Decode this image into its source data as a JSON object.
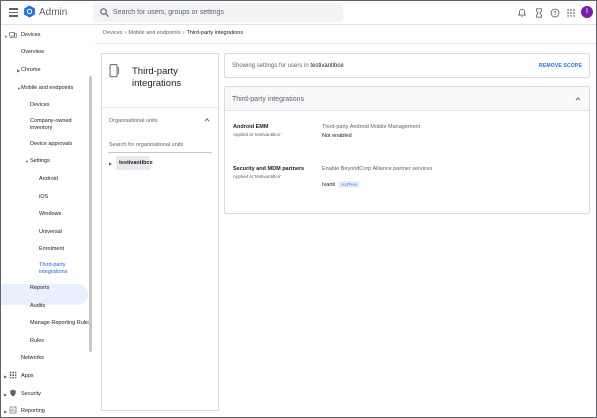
{
  "header": {
    "app_title": "Admin",
    "search_placeholder": "Search for users, groups or settings",
    "avatar_initial": "I"
  },
  "sidebar": {
    "items": [
      {
        "label": "Devices"
      },
      {
        "label": "Overview"
      },
      {
        "label": "Chrome"
      },
      {
        "label": "Mobile and endpoints"
      },
      {
        "label": "Devices"
      },
      {
        "label": "Company-owned inventory"
      },
      {
        "label": "Device approvals"
      },
      {
        "label": "Settings"
      },
      {
        "label": "Android"
      },
      {
        "label": "iOS"
      },
      {
        "label": "Windows"
      },
      {
        "label": "Universal"
      },
      {
        "label": "Enrolment"
      },
      {
        "label": "Third-party integrations"
      },
      {
        "label": "Reports"
      },
      {
        "label": "Audits"
      },
      {
        "label": "Manage Reporting Rules"
      },
      {
        "label": "Rules"
      },
      {
        "label": "Networks"
      },
      {
        "label": "Apps"
      },
      {
        "label": "Security"
      },
      {
        "label": "Reporting"
      }
    ]
  },
  "breadcrumb": {
    "items": [
      "Devices",
      "Mobile and endpoints",
      "Third-party integrations"
    ]
  },
  "org_panel": {
    "title": "Third-party integrations",
    "org_units_label": "Organisational units",
    "search_placeholder": "Search for organisational units",
    "root_unit": "testivantibce"
  },
  "scope": {
    "prefix": "Showing settings for users in ",
    "unit": "testivantibce",
    "remove_label": "REMOVE SCOPE"
  },
  "card": {
    "title": "Third-party integrations",
    "rows": [
      {
        "title": "Android EMM",
        "sub": "Applied at 'testivantibce'",
        "description": "Third-party Android Mobile Management",
        "value": "Not enabled"
      },
      {
        "title": "Security and MDM partners",
        "sub": "Applied at 'testivantibce'",
        "description": "Enable BeyondCorp Alliance partner services",
        "value": "Ivanti",
        "badge": "ALPHA"
      }
    ]
  },
  "colors": {
    "accent": "#1a73e8",
    "selected_bg": "#e8f0fe",
    "avatar": "#7b1fa2"
  },
  "icons": [
    "menu-icon",
    "admin-logo-icon",
    "search-icon",
    "bell-icon",
    "hourglass-icon",
    "help-icon",
    "apps-grid-icon",
    "devices-icon",
    "apps-icon",
    "security-icon",
    "reporting-icon",
    "phone-icon",
    "chevron-up-icon"
  ]
}
